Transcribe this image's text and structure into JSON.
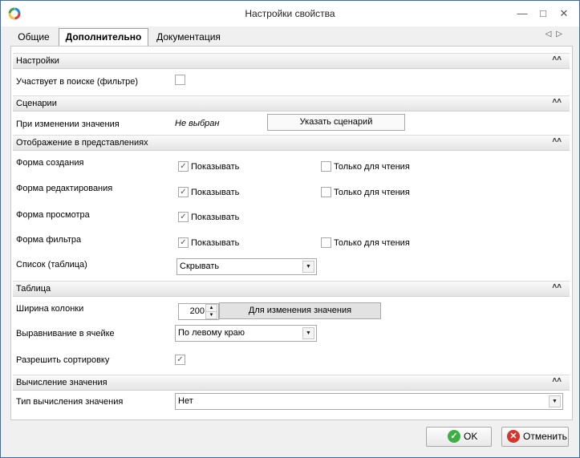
{
  "window": {
    "title": "Настройки свойства",
    "minimize_icon": "minimize-icon",
    "maximize_icon": "maximize-icon",
    "close_icon": "close-icon"
  },
  "tabs": [
    {
      "label": "Общие",
      "active": false
    },
    {
      "label": "Дополнительно",
      "active": true
    },
    {
      "label": "Документация",
      "active": false
    }
  ],
  "sections": {
    "settings": {
      "title": "Настройки",
      "participates_label": "Участвует в поиске (фильтре)",
      "participates_checked": false
    },
    "scenarios": {
      "title": "Сценарии",
      "on_change_label": "При изменении значения",
      "on_change_value": "Не выбран",
      "set_scenario_button": "Указать сценарий"
    },
    "display": {
      "title": "Отображение в представлениях",
      "rows": [
        {
          "label": "Форма создания",
          "show_label": "Показывать",
          "show_checked": true,
          "readonly_label": "Только для чтения",
          "readonly_checked": false
        },
        {
          "label": "Форма редактирования",
          "show_label": "Показывать",
          "show_checked": true,
          "readonly_label": "Только для чтения",
          "readonly_checked": false
        },
        {
          "label": "Форма просмотра",
          "show_label": "Показывать",
          "show_checked": true
        },
        {
          "label": "Форма фильтра",
          "show_label": "Показывать",
          "show_checked": true,
          "readonly_label": "Только для чтения",
          "readonly_checked": false
        }
      ],
      "list_label": "Список (таблица)",
      "list_value": "Скрывать"
    },
    "table": {
      "title": "Таблица",
      "column_width_label": "Ширина колонки",
      "column_width_value": "200",
      "column_width_button": "Для изменения значения",
      "align_label": "Выравнивание в ячейке",
      "align_value": "По левому краю",
      "sort_label": "Разрешить сортировку",
      "sort_checked": true
    },
    "calc": {
      "title": "Вычисление значения",
      "type_label": "Тип вычисления значения",
      "type_value": "Нет"
    }
  },
  "footer": {
    "ok_label": "OK",
    "cancel_label": "Отменить",
    "ok_color": "#3cb043",
    "cancel_color": "#d9342b"
  },
  "colors": {
    "border": "#3b6ea5"
  }
}
